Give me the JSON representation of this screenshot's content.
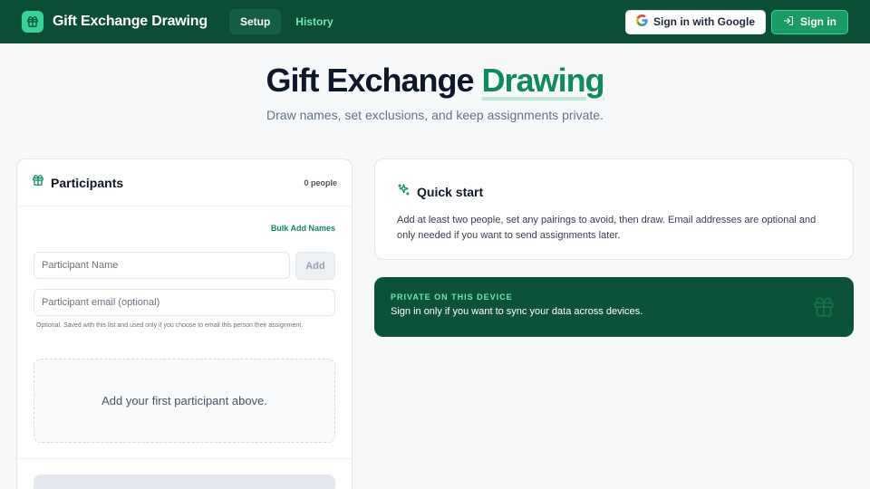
{
  "app": {
    "title": "Gift Exchange Drawing",
    "tabs": [
      {
        "label": "Setup",
        "active": true
      },
      {
        "label": "History",
        "active": false
      }
    ],
    "google_signin_label": "Sign in with Google",
    "signin_label": "Sign in"
  },
  "hero": {
    "title_main": "Gift Exchange",
    "title_accent": "Drawing",
    "subtitle": "Draw names, set exclusions, and keep assignments private."
  },
  "participants": {
    "title": "Participants",
    "count": "0 people",
    "bulk_add_label": "Bulk Add Names",
    "name_placeholder": "Participant Name",
    "add_label": "Add",
    "email_placeholder": "Participant email (optional)",
    "email_hint": "Optional. Saved with this list and used only if you choose to email this person their assignment.",
    "empty_message": "Add your first participant above."
  },
  "quick_start": {
    "title": "Quick start",
    "body": "Add at least two people, set any pairings to avoid, then draw. Email addresses are optional and only needed if you want to send assignments later."
  },
  "private_notice": {
    "label": "PRIVATE ON THIS DEVICE",
    "body": "Sign in only if you want to sync your data across devices."
  },
  "colors": {
    "nav_bg": "#0b4d35",
    "accent": "#0f8a5a",
    "accent_light": "#34d399",
    "private_bg": "#0b5238"
  },
  "icons": {
    "brand": "gift-icon",
    "google": "google-logo-icon",
    "signin": "sign-in-icon",
    "participants": "gift-icon",
    "quick_start": "sparkles-icon",
    "private": "gift-icon"
  }
}
